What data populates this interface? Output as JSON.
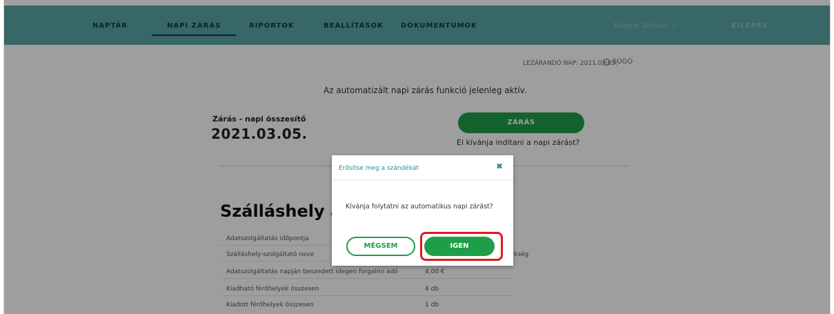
{
  "nav": {
    "items": [
      {
        "label": "NAPTÁR"
      },
      {
        "label": "NAPI ZÁRÁS"
      },
      {
        "label": "RIPORTOK"
      },
      {
        "label": "BEÁLLÍTÁSOK"
      },
      {
        "label": "DOKUMENTUMOK"
      }
    ],
    "active_index": 1,
    "user_label": "Magyar Szilvia(...)",
    "chevron": "chevron-down-icon",
    "logout_label": "KILÉPÉS"
  },
  "subheader": {
    "closing_day": "LEZÁRANDÓ NAP: 2021.03.05.",
    "help_icon": "info-icon",
    "help_label": "SÚGÓ"
  },
  "notice": "Az automatizált napi zárás funkció jelenleg aktív.",
  "summary": {
    "label": "Zárás - napi összesítő",
    "date": "2021.03.05."
  },
  "close_action": {
    "button_label": "ZÁRÁS",
    "question": "El kívánja indítani a napi zárást?"
  },
  "section": {
    "title": "Szálláshely ad",
    "rows": [
      {
        "label": "Adatszolgáltatás időpontja",
        "value": ""
      },
      {
        "label": "Szálláshely-szolgáltató neve",
        "value": "kség"
      },
      {
        "label": "Adatszolgáltatás napján beszedett idegen forgalmi adó",
        "value": "4,00 €"
      },
      {
        "label": "Kiadható férőhelyek összesen",
        "value": "4 db"
      },
      {
        "label": "Kiadott férőhelyek összesen",
        "value": "1 db"
      }
    ]
  },
  "modal": {
    "title": "Erősítse meg a szándékát",
    "close_icon": "close-icon",
    "body": "Kívánja folytatni az automatikus napi zárást?",
    "cancel_label": "MÉGSEM",
    "confirm_label": "IGEN"
  },
  "colors": {
    "nav_bg": "#5aa7a6",
    "primary_green": "#1f9e48",
    "highlight_red": "#e01a1a"
  }
}
